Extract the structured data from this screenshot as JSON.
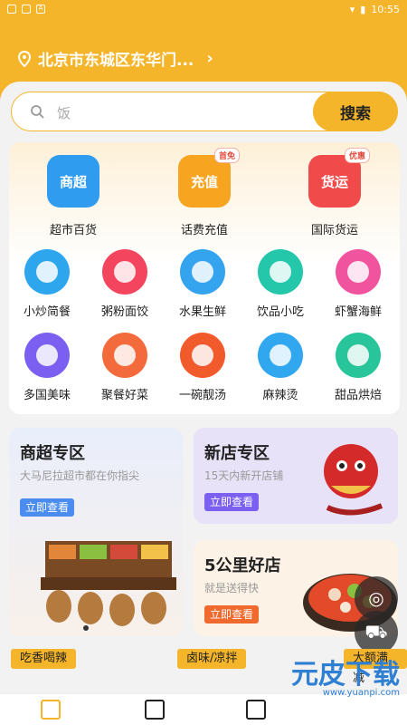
{
  "status": {
    "time": "10:55",
    "left_icons": [
      "settings-icon",
      "image-icon",
      "a-icon"
    ]
  },
  "location": {
    "text": "北京市东城区东华门..."
  },
  "search": {
    "placeholder": "饭",
    "button": "搜索"
  },
  "big_cats": [
    {
      "label": "超市百货",
      "icon_text": "商超",
      "tag": "",
      "color": "#2f9cf0"
    },
    {
      "label": "话费充值",
      "icon_text": "充值",
      "tag": "首免",
      "color": "#f7a521"
    },
    {
      "label": "国际货运",
      "icon_text": "货运",
      "tag": "优惠",
      "color": "#f04a4a"
    }
  ],
  "small_cats": [
    {
      "label": "小炒简餐",
      "color": "#2ea6ee"
    },
    {
      "label": "粥粉面饺",
      "color": "#f4455f"
    },
    {
      "label": "水果生鲜",
      "color": "#34a4ee"
    },
    {
      "label": "饮品小吃",
      "color": "#24c7a9"
    },
    {
      "label": "虾蟹海鲜",
      "color": "#f0549e"
    },
    {
      "label": "多国美味",
      "color": "#7b5ff0"
    },
    {
      "label": "聚餐好菜",
      "color": "#f36a3d"
    },
    {
      "label": "一碗靓汤",
      "color": "#f15a2b"
    },
    {
      "label": "麻辣烫",
      "color": "#31a7f0"
    },
    {
      "label": "甜品烘焙",
      "color": "#28c59a"
    }
  ],
  "promos": {
    "supermarket": {
      "title": "商超专区",
      "sub": "大马尼拉超市都在你指尖",
      "cta": "立即查看"
    },
    "newstore": {
      "title": "新店专区",
      "sub": "15天内新开店铺",
      "cta": "立即查看"
    },
    "nearby": {
      "title": "5公里好店",
      "sub": "就是送得快",
      "cta": "立即查看"
    }
  },
  "chips": [
    "吃香喝辣",
    "卤味/凉拌",
    "大额满减"
  ],
  "watermark": {
    "text": "元皮下载",
    "url": "www.yuanpi.com"
  }
}
